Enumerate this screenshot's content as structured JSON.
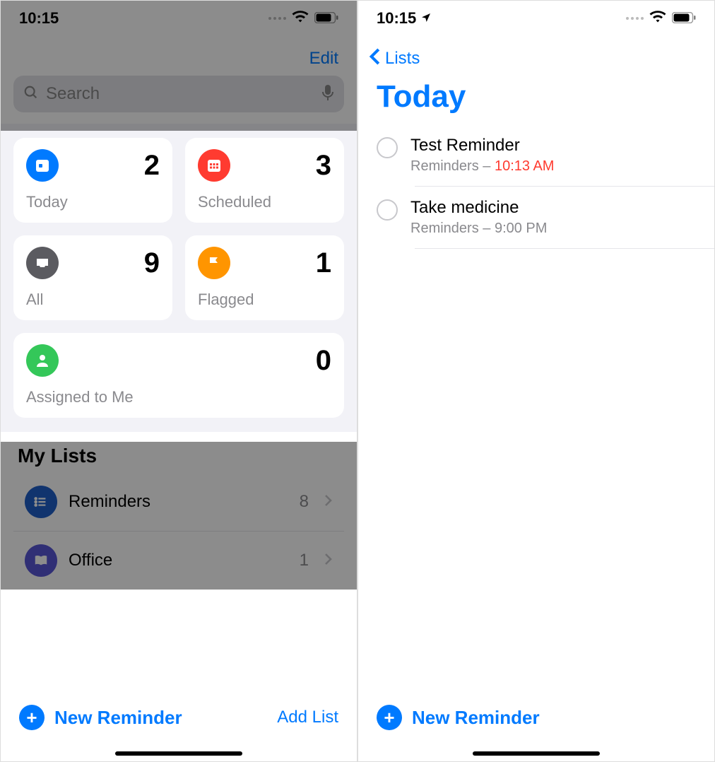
{
  "colors": {
    "accent": "#007aff",
    "danger": "#ff3b30"
  },
  "left": {
    "status": {
      "time": "10:15"
    },
    "edit_label": "Edit",
    "search": {
      "placeholder": "Search"
    },
    "smart": [
      {
        "id": "today",
        "label": "Today",
        "count": 2,
        "icon": "calendar-today",
        "color": "blue"
      },
      {
        "id": "scheduled",
        "label": "Scheduled",
        "count": 3,
        "icon": "calendar-grid",
        "color": "red"
      },
      {
        "id": "all",
        "label": "All",
        "count": 9,
        "icon": "tray",
        "color": "gray"
      },
      {
        "id": "flagged",
        "label": "Flagged",
        "count": 1,
        "icon": "flag",
        "color": "orange"
      },
      {
        "id": "assigned",
        "label": "Assigned to Me",
        "count": 0,
        "icon": "person",
        "color": "green"
      }
    ],
    "mylists_title": "My Lists",
    "lists": [
      {
        "id": "reminders",
        "label": "Reminders",
        "count": 8,
        "icon": "list",
        "color": "dblue"
      },
      {
        "id": "office",
        "label": "Office",
        "count": 1,
        "icon": "book",
        "color": "purple"
      }
    ],
    "new_reminder_label": "New Reminder",
    "add_list_label": "Add List"
  },
  "right": {
    "status": {
      "time": "10:15"
    },
    "back_label": "Lists",
    "title": "Today",
    "reminders": [
      {
        "title": "Test Reminder",
        "list": "Reminders",
        "time": "10:13 AM",
        "time_overdue": true
      },
      {
        "title": "Take medicine",
        "list": "Reminders",
        "time": "9:00 PM",
        "time_overdue": false
      }
    ],
    "new_reminder_label": "New Reminder"
  }
}
